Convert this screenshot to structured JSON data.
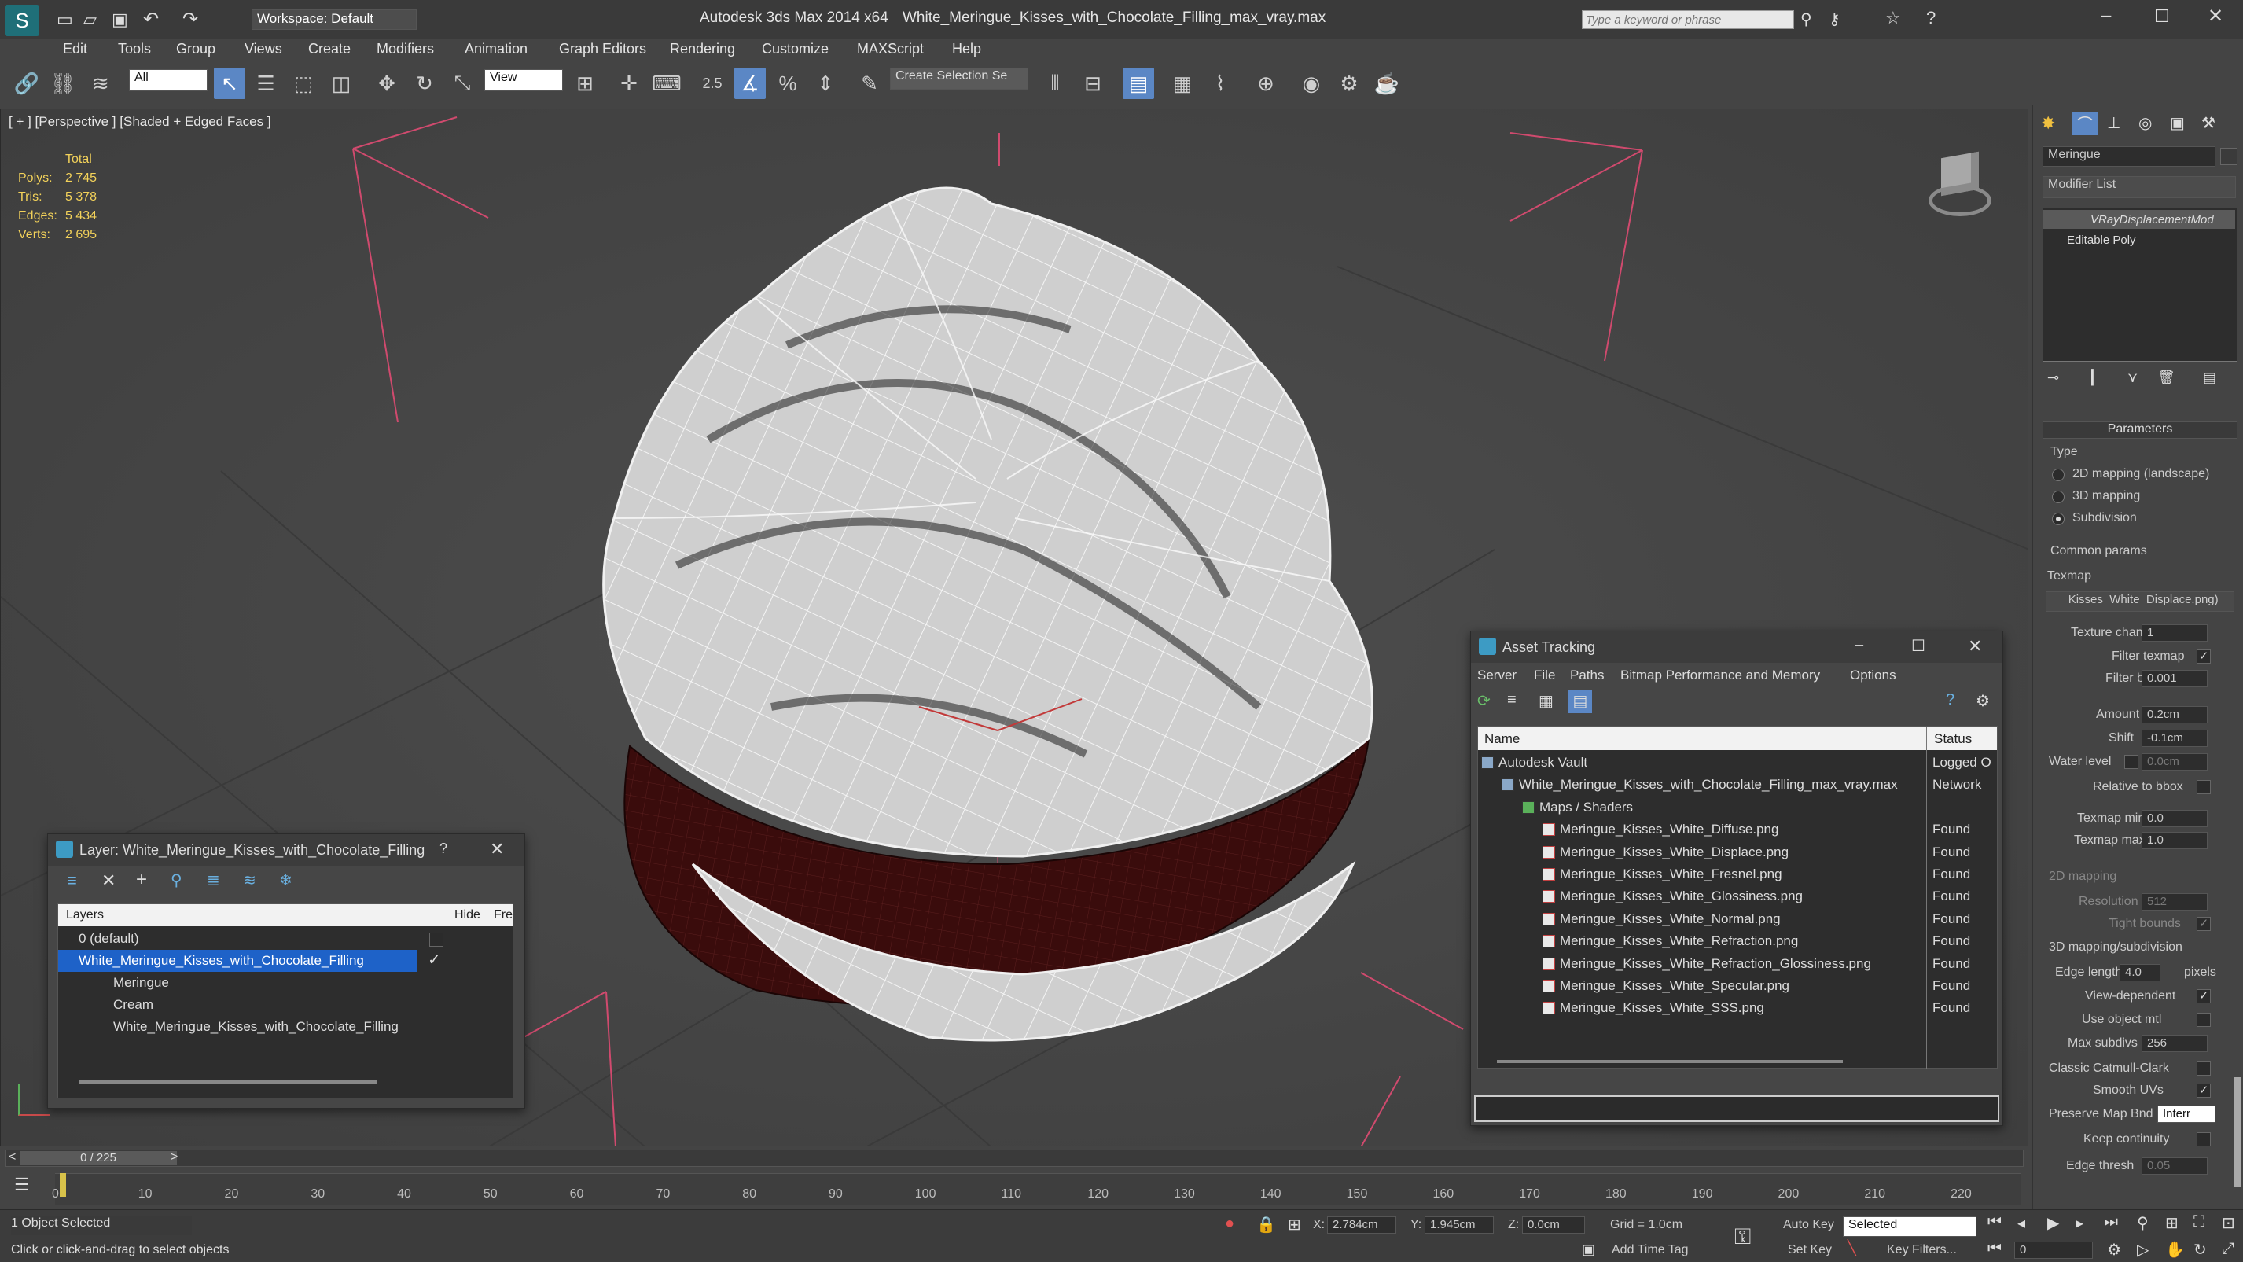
{
  "app": {
    "title": "Autodesk 3ds Max  2014 x64",
    "file": "White_Meringue_Kisses_with_Chocolate_Filling_max_vray.max",
    "workspace": "Workspace: Default",
    "search_placeholder": "Type a keyword or phrase"
  },
  "menu": [
    "Edit",
    "Tools",
    "Group",
    "Views",
    "Create",
    "Modifiers",
    "Animation",
    "Graph Editors",
    "Rendering",
    "Customize",
    "MAXScript",
    "Help"
  ],
  "toolbar": {
    "filter": "All",
    "refcoord": "View",
    "selection_set": "Create Selection Se",
    "snap_angle": "2.5"
  },
  "viewport": {
    "label": "[ + ] [Perspective ] [Shaded + Edged Faces ]",
    "stats": {
      "header": "Total",
      "polys_label": "Polys:",
      "polys": "2 745",
      "tris_label": "Tris:",
      "tris": "5 378",
      "edges_label": "Edges:",
      "edges": "5 434",
      "verts_label": "Verts:",
      "verts": "2 695"
    }
  },
  "layer_window": {
    "title": "Layer: White_Meringue_Kisses_with_Chocolate_Filling",
    "help": "?",
    "columns": [
      "Layers",
      "Hide",
      "Fre"
    ],
    "rows": [
      "0 (default)",
      "White_Meringue_Kisses_with_Chocolate_Filling",
      "Meringue",
      "Cream",
      "White_Meringue_Kisses_with_Chocolate_Filling"
    ]
  },
  "asset_window": {
    "title": "Asset Tracking",
    "menu": [
      "Server",
      "File",
      "Paths",
      "Bitmap Performance and Memory",
      "Options"
    ],
    "columns": [
      "Name",
      "Status"
    ],
    "rows": [
      {
        "name": "Autodesk Vault",
        "status": "Logged O"
      },
      {
        "name": "White_Meringue_Kisses_with_Chocolate_Filling_max_vray.max",
        "status": "Network"
      },
      {
        "name": "Maps / Shaders",
        "status": ""
      },
      {
        "name": "Meringue_Kisses_White_Diffuse.png",
        "status": "Found"
      },
      {
        "name": "Meringue_Kisses_White_Displace.png",
        "status": "Found"
      },
      {
        "name": "Meringue_Kisses_White_Fresnel.png",
        "status": "Found"
      },
      {
        "name": "Meringue_Kisses_White_Glossiness.png",
        "status": "Found"
      },
      {
        "name": "Meringue_Kisses_White_Normal.png",
        "status": "Found"
      },
      {
        "name": "Meringue_Kisses_White_Refraction.png",
        "status": "Found"
      },
      {
        "name": "Meringue_Kisses_White_Refraction_Glossiness.png",
        "status": "Found"
      },
      {
        "name": "Meringue_Kisses_White_Specular.png",
        "status": "Found"
      },
      {
        "name": "Meringue_Kisses_White_SSS.png",
        "status": "Found"
      }
    ]
  },
  "cmd": {
    "object_name": "Meringue",
    "modifier_list": "Modifier List",
    "stack": [
      "VRayDisplacementMod",
      "Editable Poly"
    ],
    "params_title": "Parameters",
    "type_label": "Type",
    "types": [
      "2D mapping (landscape)",
      "3D mapping",
      "Subdivision"
    ],
    "common_params": "Common params",
    "texmap_label": "Texmap",
    "texmap": "_Kisses_White_Displace.png)",
    "texture_chan_label": "Texture chan",
    "texture_chan": "1",
    "filter_texmap_label": "Filter texmap",
    "filter_blur_label": "Filter blur",
    "filter_blur": "0.001",
    "amount_label": "Amount",
    "amount": "0.2cm",
    "shift_label": "Shift",
    "shift": "-0.1cm",
    "water_level_label": "Water level",
    "water_level": "0.0cm",
    "relative_label": "Relative to bbox",
    "texmap_min_label": "Texmap min",
    "texmap_min": "0.0",
    "texmap_max_label": "Texmap max",
    "texmap_max": "1.0",
    "mapping2d": "2D mapping",
    "resolution_label": "Resolution",
    "resolution": "512",
    "tight_label": "Tight bounds",
    "mapping3d": "3D mapping/subdivision",
    "edge_length_label": "Edge length",
    "edge_length": "4.0",
    "pixels": "pixels",
    "view_dep_label": "View-dependent",
    "use_obj_label": "Use object mtl",
    "max_subdivs_label": "Max subdivs",
    "max_subdivs": "256",
    "catmull_label": "Classic Catmull-Clark",
    "smooth_uvs_label": "Smooth UVs",
    "preserve_label": "Preserve Map Bnd",
    "preserve": "Interr",
    "keep_label": "Keep continuity",
    "edge_thresh_label": "Edge thresh",
    "edge_thresh": "0.05"
  },
  "timeline": {
    "frame": "0 / 225",
    "ticks": [
      "0",
      "10",
      "20",
      "30",
      "40",
      "50",
      "60",
      "70",
      "80",
      "90",
      "100",
      "110",
      "120",
      "130",
      "140",
      "150",
      "160",
      "170",
      "180",
      "190",
      "200",
      "210",
      "220"
    ]
  },
  "status": {
    "selected": "1 Object Selected",
    "prompt": "Click or click-and-drag to select objects",
    "x_label": "X:",
    "x": "2.784cm",
    "y_label": "Y:",
    "y": "1.945cm",
    "z_label": "Z:",
    "z": "0.0cm",
    "grid": "Grid = 1.0cm",
    "add_time_tag": "Add Time Tag",
    "auto_key": "Auto Key",
    "set_key": "Set Key",
    "key_mode": "Selected",
    "key_filters": "Key Filters...",
    "frame": "0"
  }
}
